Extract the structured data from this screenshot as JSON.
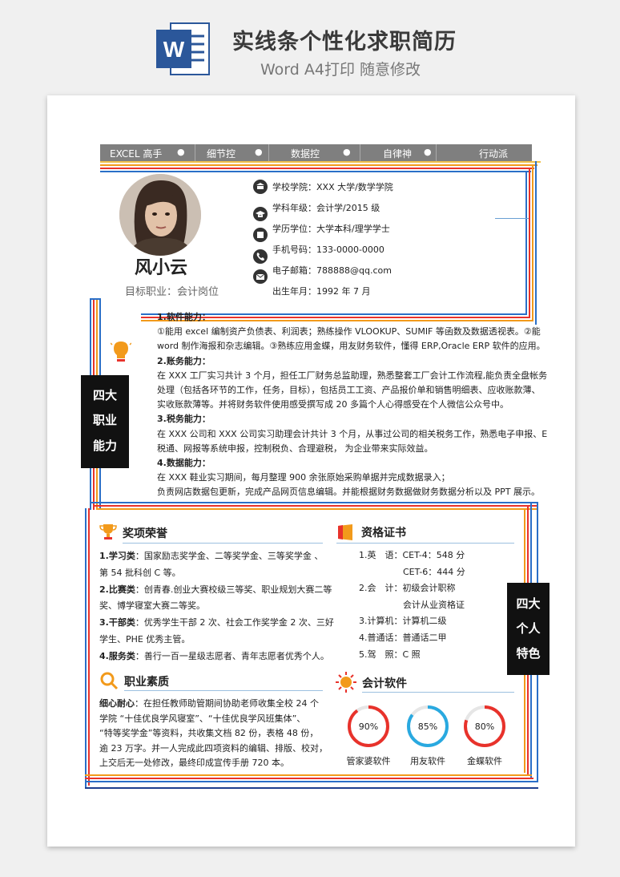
{
  "banner": {
    "title": "实线条个性化求职简历",
    "subtitle": "Word A4打印 随意修改",
    "word_letter": "W"
  },
  "topnav": [
    "EXCEL 高手",
    "细节控",
    "数据控",
    "自律神",
    "行动派"
  ],
  "profile": {
    "name": "风小云",
    "target": "目标职业：会计岗位"
  },
  "info": [
    {
      "icon": "school-icon",
      "text": "学校学院：XXX 大学/数学学院"
    },
    {
      "icon": "graduation-cap-icon",
      "text": "学科年级：会计学/2015 级"
    },
    {
      "icon": "diploma-icon",
      "text": "学历学位：大学本科/理学学士"
    },
    {
      "icon": "phone-icon",
      "text": "手机号码：133-0000-0000"
    },
    {
      "icon": "mail-icon",
      "text": "电子邮箱：788888@qq.com"
    },
    {
      "icon": "calendar-icon",
      "text": "出生年月：1992 年 7 月"
    }
  ],
  "abilities": {
    "side_label": [
      "四大",
      "职业",
      "能力"
    ],
    "lines": [
      {
        "text": "1.软件能力：",
        "bold": true
      },
      {
        "text": "①能用 excel 编制资产负债表、利润表；熟练操作 VLOOKUP、SUMIF 等函数及数据透视表。②能",
        "bold": false
      },
      {
        "text": "word 制作海报和杂志编辑。③熟练应用金蝶，用友财务软件，懂得 ERP,Oracle ERP 软件的应用。",
        "bold": false
      },
      {
        "text": "2.账务能力：",
        "bold": true
      },
      {
        "text": "在 XXX 工厂实习共计 3 个月，担任工厂财务总监助理，熟悉整套工厂会计工作流程,能负责全盘帐务",
        "bold": false
      },
      {
        "text": "处理（包括各环节的工作，任务，目标），包括员工工资、产品报价单和销售明细表、应收账款薄、",
        "bold": false
      },
      {
        "text": "实收账款薄等。并将财务软件使用感受撰写成 20 多篇个人心得感受在个人微信公众号中。",
        "bold": false
      },
      {
        "text": "3.税务能力：",
        "bold": true
      },
      {
        "text": "在 XXX 公司和 XXX 公司实习助理会计共计 3 个月，从事过公司的相关税务工作，熟悉电子申报、E",
        "bold": false
      },
      {
        "text": "税通、网报等系统申报，控制税负、合理避税，  为企业带来实际效益。",
        "bold": false
      },
      {
        "text": "4.数据能力：",
        "bold": true
      },
      {
        "text": "在 XXX 鞋业实习期间，每月整理 900 余张原始采购单据并完成数据录入；",
        "bold": false
      },
      {
        "text": "负责网店数据包更新，完成产品网页信息编辑。并能根据财务数据做财务数据分析以及 PPT 展示。",
        "bold": false
      }
    ]
  },
  "awards": {
    "title": "奖项荣誉",
    "lines": [
      {
        "label": "1.学习类",
        "text": "：国家励志奖学金、二等奖学金、三等奖学金 、"
      },
      {
        "label": "",
        "text": "第 54 批科创 C 等。"
      },
      {
        "label": "2.比赛类",
        "text": "：创青春.创业大赛校级三等奖、职业规划大赛二等"
      },
      {
        "label": "",
        "text": "奖、博学寝室大赛二等奖。"
      },
      {
        "label": "3.干部类",
        "text": "：优秀学生干部 2 次、社会工作奖学金 2 次、三好"
      },
      {
        "label": "",
        "text": "学生、PHE 优秀主管。"
      },
      {
        "label": "4.服务类",
        "text": "：善行一百一星级志愿者、青年志愿者优秀个人。"
      }
    ]
  },
  "certificates": {
    "title": "资格证书",
    "lines": [
      "1.英　语：CET-4：548 分",
      "　　　　　CET-6：444 分",
      "2.会　计：初级会计职称",
      "　　　　　会计从业资格证",
      "3.计算机：计算机二级",
      "4.普通话：普通话二甲",
      "5.驾　照：C 照"
    ]
  },
  "personal": {
    "side_label": [
      "四大",
      "个人",
      "特色"
    ]
  },
  "quality": {
    "title": "职业素质",
    "label": "细心耐心",
    "lines": [
      "：在担任教师助管期间协助老师收集全校 24 个",
      "学院 “十佳优良学风寝室”、“十佳优良学风班集体”、",
      "“特等奖学金”等资料，共收集文档 82 份，表格 48 份，",
      "逾 23 万字。并一人完成此四项资料的编辑、排版、校对，",
      "上交后无一处修改，最终印成宣传手册 720 本。"
    ]
  },
  "software": {
    "title": "会计软件",
    "items": [
      {
        "name": "管家婆软件",
        "percent": "90%",
        "value": 0.9,
        "color": "#e8322b"
      },
      {
        "name": "用友软件",
        "percent": "85%",
        "value": 0.85,
        "color": "#29a9e0"
      },
      {
        "name": "金蝶软件",
        "percent": "80%",
        "value": 0.8,
        "color": "#e8322b"
      }
    ]
  },
  "colors": {
    "orange": "#f29a1b",
    "red": "#e8322b",
    "blue": "#2a6fc8",
    "navy": "#1d3f8f",
    "gray": "#7f7f7f"
  }
}
